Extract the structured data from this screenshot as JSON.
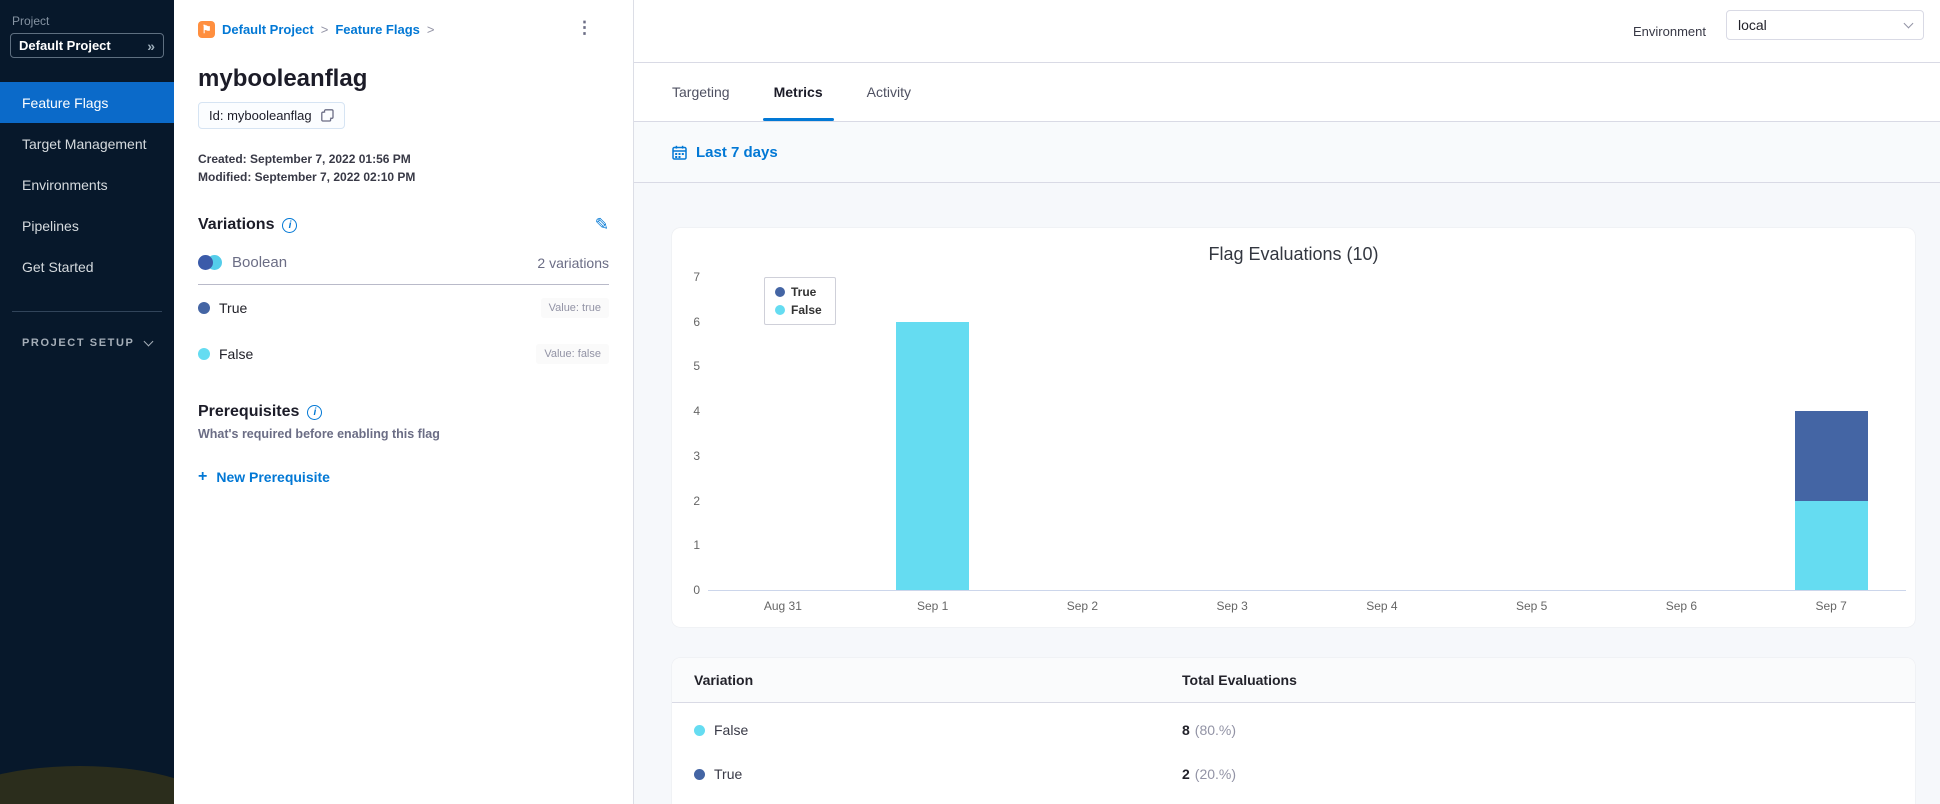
{
  "icons": {
    "kebab": "⋮",
    "double_chevron": "»",
    "breadcrumb_separator": ">",
    "plus": "+",
    "info": "i",
    "pencil": "✎",
    "flag_logo": "⚑"
  },
  "sidebar": {
    "project_label": "Project",
    "project_name": "Default Project",
    "items": [
      {
        "label": "Feature Flags",
        "active": true
      },
      {
        "label": "Target Management",
        "active": false
      },
      {
        "label": "Environments",
        "active": false
      },
      {
        "label": "Pipelines",
        "active": false
      },
      {
        "label": "Get Started",
        "active": false
      }
    ],
    "section_label": "PROJECT SETUP"
  },
  "header": {
    "environment_label": "Environment",
    "environment_value": "local"
  },
  "detail": {
    "breadcrumbs": [
      "Default Project",
      "Feature Flags"
    ],
    "title": "mybooleanflag",
    "id_label": "Id: mybooleanflag",
    "created": "Created: September 7, 2022 01:56 PM",
    "modified": "Modified: September 7, 2022 02:10 PM",
    "variations": {
      "heading": "Variations",
      "type_label": "Boolean",
      "count_label": "2 variations",
      "items": [
        {
          "name": "True",
          "value_label": "Value: true",
          "color": "#4465a4"
        },
        {
          "name": "False",
          "value_label": "Value: false",
          "color": "#65dcf1"
        }
      ]
    },
    "prerequisites": {
      "heading": "Prerequisites",
      "subtitle": "What's required before enabling this flag",
      "new_button_label": "New Prerequisite"
    }
  },
  "tabs": {
    "items": [
      {
        "label": "Targeting",
        "active": false
      },
      {
        "label": "Metrics",
        "active": true
      },
      {
        "label": "Activity",
        "active": false
      }
    ]
  },
  "filter": {
    "date_range_label": "Last 7 days"
  },
  "chart_data": {
    "type": "bar",
    "stacked": true,
    "title": "Flag Evaluations (10)",
    "categories": [
      "Aug 31",
      "Sep 1",
      "Sep 2",
      "Sep 3",
      "Sep 4",
      "Sep 5",
      "Sep 6",
      "Sep 7"
    ],
    "series": [
      {
        "name": "True",
        "color": "#4465a4",
        "values": [
          0,
          0,
          0,
          0,
          0,
          0,
          0,
          2
        ]
      },
      {
        "name": "False",
        "color": "#65dcf1",
        "values": [
          0,
          6,
          0,
          0,
          0,
          0,
          0,
          2
        ]
      }
    ],
    "ylim": [
      0,
      7
    ],
    "yticks": [
      0,
      1,
      2,
      3,
      4,
      5,
      6,
      7
    ],
    "xlabel": "",
    "ylabel": "",
    "legend_position": "top-left",
    "grid": false
  },
  "table": {
    "headers": [
      "Variation",
      "Total Evaluations"
    ],
    "rows": [
      {
        "variation": "False",
        "dot_color": "#65dcf1",
        "count": "8",
        "percent": "(80.%)"
      },
      {
        "variation": "True",
        "dot_color": "#4465a4",
        "count": "2",
        "percent": "(20.%)"
      }
    ]
  }
}
